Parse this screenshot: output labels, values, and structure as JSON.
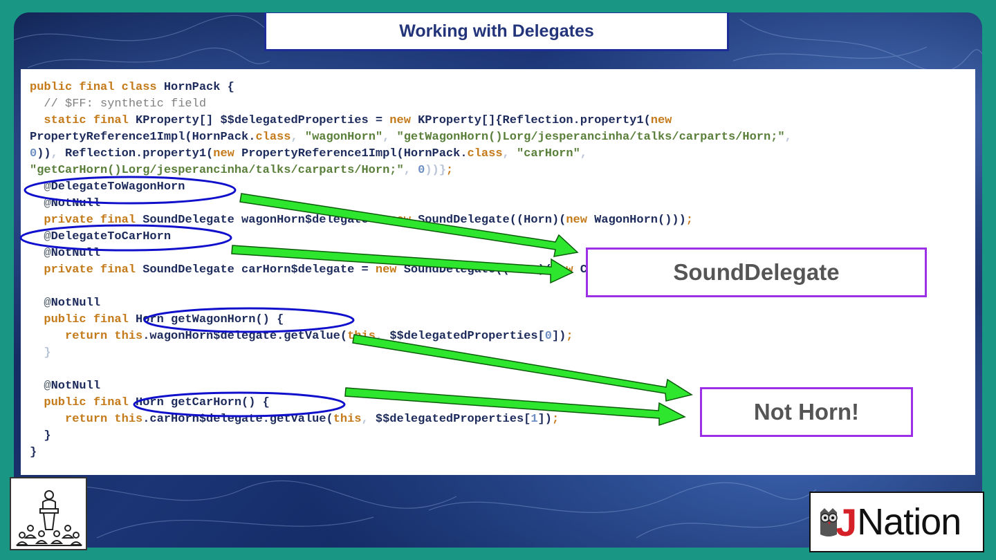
{
  "slide": {
    "title": "Working with Delegates"
  },
  "code": {
    "lines": [
      [
        [
          "k",
          "public final class "
        ],
        [
          "",
          "HornPack {"
        ]
      ],
      [
        [
          "c",
          "  // $FF: synthetic field"
        ]
      ],
      [
        [
          "k",
          "  static final "
        ],
        [
          "",
          "KProperty[] $$delegatedProperties = "
        ],
        [
          "k",
          "new "
        ],
        [
          "",
          "KProperty[]{Reflection.property1("
        ],
        [
          "k",
          "new"
        ]
      ],
      [
        [
          "",
          "PropertyReference1Impl(HornPack."
        ],
        [
          "k",
          "class"
        ],
        [
          "p",
          ", "
        ],
        [
          "s",
          "\"wagonHorn\""
        ],
        [
          "p",
          ", "
        ],
        [
          "s",
          "\"getWagonHorn()Lorg/jesperancinha/talks/carparts/Horn;\""
        ],
        [
          "p",
          ","
        ]
      ],
      [
        [
          "n",
          "0"
        ],
        [
          "",
          "))"
        ],
        [
          "p",
          ", "
        ],
        [
          "",
          "Reflection.property1("
        ],
        [
          "k",
          "new "
        ],
        [
          "",
          "PropertyReference1Impl(HornPack."
        ],
        [
          "k",
          "class"
        ],
        [
          "p",
          ", "
        ],
        [
          "s",
          "\"carHorn\""
        ],
        [
          "p",
          ","
        ]
      ],
      [
        [
          "s",
          "\"getCarHorn()Lorg/jesperancinha/talks/carparts/Horn;\""
        ],
        [
          "p",
          ", "
        ],
        [
          "n",
          "0"
        ],
        [
          "p",
          "))}"
        ],
        [
          "k",
          ";"
        ]
      ],
      [
        [
          "a",
          "  @"
        ],
        [
          "",
          "DelegateToWagonHorn"
        ]
      ],
      [
        [
          "a",
          "  @"
        ],
        [
          "",
          "NotNull"
        ]
      ],
      [
        [
          "k",
          "  private final "
        ],
        [
          "",
          "SoundDelegate wagonHorn$delegate = "
        ],
        [
          "k",
          "new "
        ],
        [
          "",
          "SoundDelegate((Horn)("
        ],
        [
          "k",
          "new "
        ],
        [
          "",
          "WagonHorn()))"
        ],
        [
          "k",
          ";"
        ]
      ],
      [
        [
          "a",
          "  @"
        ],
        [
          "",
          "DelegateToCarHorn"
        ]
      ],
      [
        [
          "a",
          "  @"
        ],
        [
          "",
          "NotNull"
        ]
      ],
      [
        [
          "k",
          "  private final "
        ],
        [
          "",
          "SoundDelegate carHorn$delegate = "
        ],
        [
          "k",
          "new "
        ],
        [
          "",
          "SoundDelegate((Horn)("
        ],
        [
          "k",
          "new "
        ],
        [
          "",
          "CarHorn()))"
        ],
        [
          "k",
          ";"
        ]
      ],
      [
        [
          "",
          ""
        ]
      ],
      [
        [
          "a",
          "  @"
        ],
        [
          "",
          "NotNull"
        ]
      ],
      [
        [
          "k",
          "  public final "
        ],
        [
          "",
          "Horn getWagonHorn() {"
        ]
      ],
      [
        [
          "k",
          "     return this"
        ],
        [
          "",
          ".wagonHorn$delegate.getValue("
        ],
        [
          "k",
          "this"
        ],
        [
          "p",
          ", "
        ],
        [
          "",
          "$$delegatedProperties["
        ],
        [
          "n",
          "0"
        ],
        [
          "",
          "])"
        ],
        [
          "k",
          ";"
        ]
      ],
      [
        [
          "p",
          "  }"
        ]
      ],
      [
        [
          "",
          ""
        ]
      ],
      [
        [
          "a",
          "  @"
        ],
        [
          "",
          "NotNull"
        ]
      ],
      [
        [
          "k",
          "  public final "
        ],
        [
          "",
          "Horn getCarHorn() {"
        ]
      ],
      [
        [
          "k",
          "     return this"
        ],
        [
          "",
          ".carHorn$delegate.getValue("
        ],
        [
          "k",
          "this"
        ],
        [
          "p",
          ", "
        ],
        [
          "",
          "$$delegatedProperties["
        ],
        [
          "n",
          "1"
        ],
        [
          "",
          "])"
        ],
        [
          "k",
          ";"
        ]
      ],
      [
        [
          "",
          "  }"
        ]
      ],
      [
        [
          "",
          "}"
        ]
      ]
    ]
  },
  "labels": {
    "sound_delegate": "SoundDelegate",
    "not_horn": "Not Horn!"
  },
  "logo": {
    "brand_letter": "J",
    "brand_word": "Nation"
  },
  "icons": {
    "speaker": "presenter-podium-icon",
    "owl": "owl-icon"
  },
  "colors": {
    "background": "#1a9684",
    "title_border": "#1c2c99",
    "title_text": "#23347a",
    "keyword": "#c47a19",
    "string": "#5a7f3a",
    "ellipse": "#1010cc",
    "arrow_fill": "#2ee62e",
    "label_border": "#9b30e6",
    "logo_j": "#d52027"
  }
}
